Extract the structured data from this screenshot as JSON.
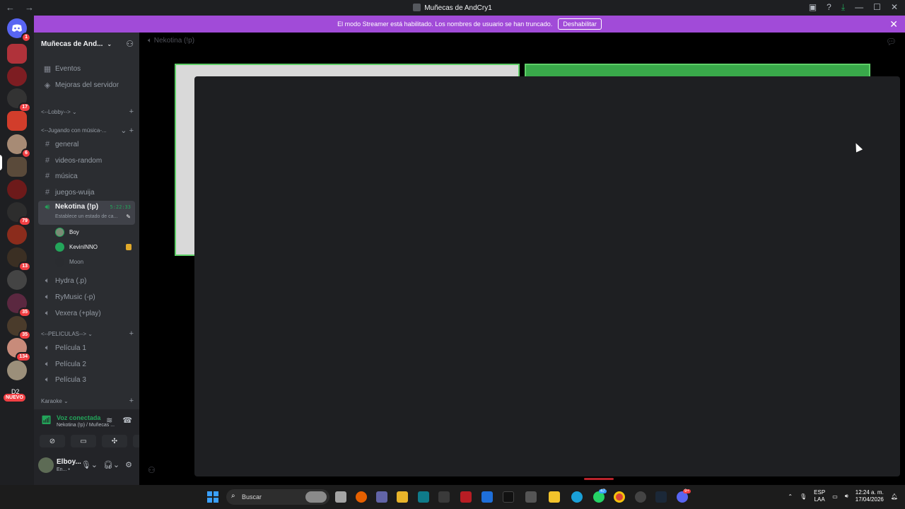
{
  "window": {
    "title": "Muñecas de AndCry1",
    "nav_back": "←",
    "nav_forward": "→"
  },
  "banner": {
    "message": "El modo Streamer está habilitado. Los nombres de usuario se han truncado.",
    "button": "Deshabilitar"
  },
  "rail": {
    "home_badge": "1",
    "badges": [
      "17",
      "6",
      "79",
      "13",
      "35",
      "35",
      "134"
    ],
    "new_label": "NUEVO",
    "d2_label": "D2"
  },
  "server": {
    "name": "Muñecas de And..."
  },
  "channels": {
    "events": "Eventos",
    "boosts": "Mejoras del servidor",
    "cat_lobby": "<--Lobby-->",
    "cat_music": "<--Jugando con música-...",
    "general": "general",
    "videos": "videos-random",
    "musica": "música",
    "juegos": "juegos-wuija",
    "active_voice": "Nekotina (!p)",
    "active_time": "5:22:33",
    "active_status": "Establece un estado de ca...",
    "users": [
      "Boy",
      "KevinINNO",
      "Moon"
    ],
    "hydra": "Hydra (.p)",
    "rymusic": "RyMusic (-p)",
    "vexera": "Vexera (+play)",
    "cat_peliculas": "<--PELICULAS-->",
    "pelicula1": "Película 1",
    "pelicula2": "Película 2",
    "pelicula3": "Película 3",
    "cat_karaoke": "Karaoke"
  },
  "voice": {
    "status": "Voz conectada",
    "location": "Nekotina (!p) / Muñecas ..."
  },
  "user": {
    "name": "Elboy...",
    "status": "En... •"
  },
  "main": {
    "channel_header": "Nekotina (!p)"
  },
  "taskbar": {
    "search_placeholder": "Buscar",
    "lang_top": "ESP",
    "lang_bottom": "LAA",
    "time": "12:24 a. m.",
    "date": "17/04/2026",
    "badge_whatsapp": "47",
    "badge_discord": "9+"
  },
  "colors": {
    "accent": "#5865f2",
    "banner": "#a14bd8",
    "voice_green": "#23a55a",
    "danger": "#f23f43"
  }
}
